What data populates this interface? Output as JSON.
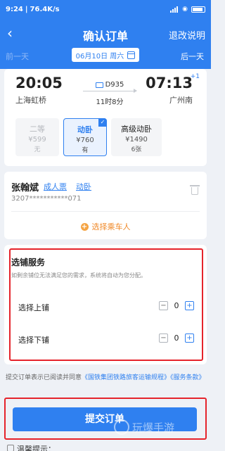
{
  "status": {
    "time": "9:24",
    "speed": "76.4K/s",
    "battery_level": 0.85
  },
  "header": {
    "title": "确认订单",
    "refund_label": "退改说明"
  },
  "daybar": {
    "prev_label": "前一天",
    "date_label": "06月10日 周六",
    "next_label": "后一天"
  },
  "train": {
    "dep_time": "20:05",
    "dep_station": "上海虹桥",
    "arr_time": "07:13",
    "arr_plus": "+1",
    "arr_station": "广州南",
    "number": "D935",
    "duration": "11时8分"
  },
  "seats": [
    {
      "name": "二等",
      "price": "¥599",
      "count": "无",
      "state": "off"
    },
    {
      "name": "动卧",
      "price": "¥760",
      "count": "有",
      "state": "selected"
    },
    {
      "name": "高级动卧",
      "price": "¥1490",
      "count": "6张",
      "state": "normal"
    }
  ],
  "passenger": {
    "name": "张翰斌",
    "type": "成人票",
    "berth": "动卧",
    "id": "3207***********071",
    "add_label": "选择乘车人"
  },
  "berth": {
    "title": "选铺服务",
    "desc": "如剩余铺位无法满足您的需求，系统将自动为您分配。",
    "upper_label": "选择上铺",
    "upper_value": "0",
    "lower_label": "选择下铺",
    "lower_value": "0"
  },
  "agree": {
    "prefix": "提交订单表示已阅读并同意",
    "link": "《国铁集团铁路旅客运输规程》《服务条款》"
  },
  "submit_label": "提交订单",
  "tip_label": "温馨提示：",
  "watermark": "玩爆手游",
  "colors": {
    "primary": "#2f80f0",
    "highlight": "#e5232b",
    "accent": "#f08a2a"
  }
}
